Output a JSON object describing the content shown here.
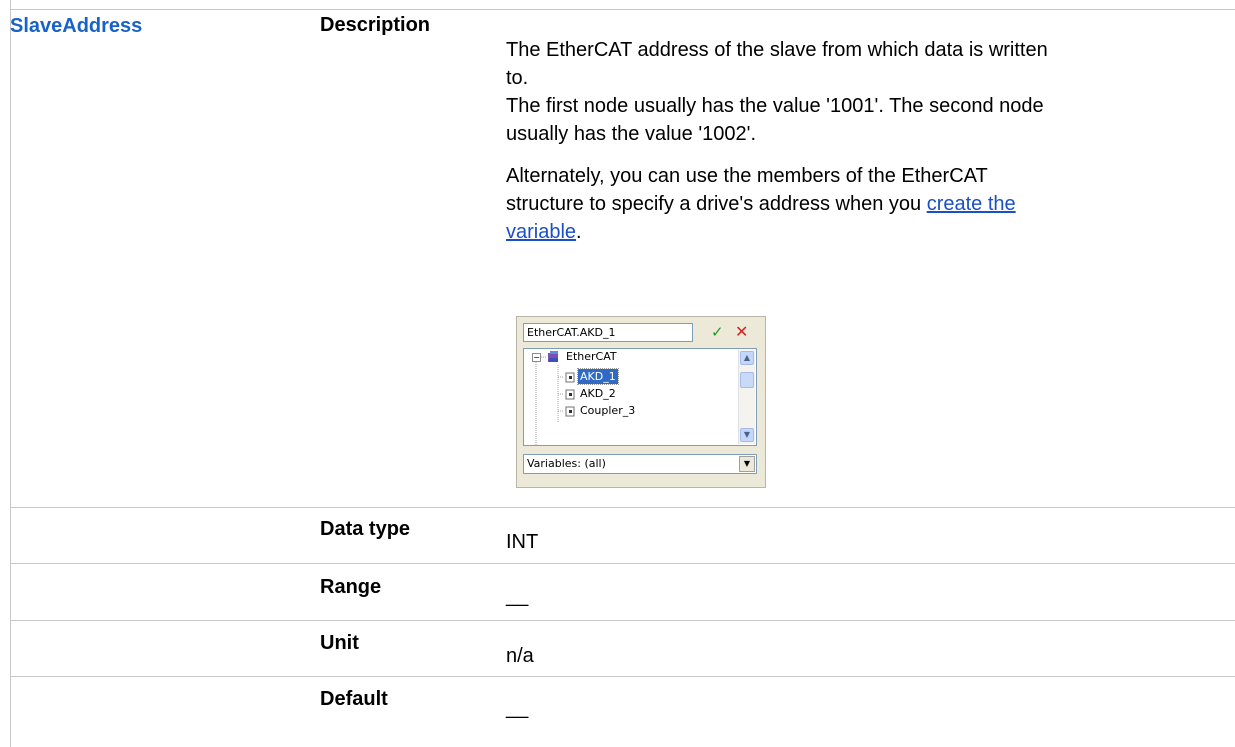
{
  "parameter": {
    "name": "SlaveAddress",
    "rows": {
      "description_label": "Description",
      "datatype_label": "Data type",
      "datatype_value": "INT",
      "range_label": "Range",
      "range_value": "__",
      "unit_label": "Unit",
      "unit_value": "n/a",
      "default_label": "Default",
      "default_value": "__"
    },
    "description": {
      "para1_line1": "The EtherCAT address of the slave from which data is written",
      "para1_line2": "to.",
      "para1_line3": "The first node usually has the value '1001'. The second node",
      "para1_line4": "usually has the value '1002'.",
      "para2_line1": "Alternately, you can use the members of the EtherCAT",
      "para2_line2_text": "structure to specify a drive's address when you ",
      "para2_link_part1": "create the",
      "para2_link_part2": "variable",
      "para2_end": "."
    }
  },
  "widget": {
    "input_value": "EtherCAT.AKD_1",
    "ok_glyph": "✓",
    "cancel_glyph": "✕",
    "tree": {
      "root": "EtherCAT",
      "items": [
        "AKD_1",
        "AKD_2",
        "Coupler_3"
      ],
      "selected": "AKD_1"
    },
    "filter_label": "Variables: (all)"
  },
  "colors": {
    "param_name": "#1763c9",
    "link": "#1a4fc7",
    "selection": "#316ac5",
    "grid": "#c8c8c8"
  }
}
